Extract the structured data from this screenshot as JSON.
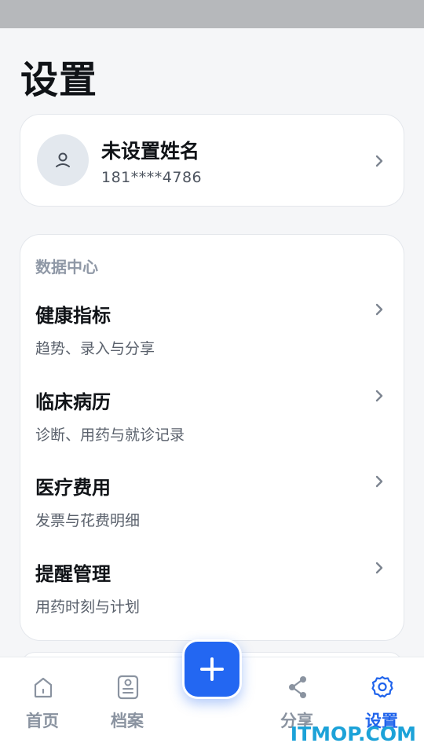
{
  "page": {
    "title": "设置"
  },
  "profile": {
    "name": "未设置姓名",
    "phone": "181****4786"
  },
  "data_center": {
    "label": "数据中心",
    "items": [
      {
        "title": "健康指标",
        "subtitle": "趋势、录入与分享"
      },
      {
        "title": "临床病历",
        "subtitle": "诊断、用药与就诊记录"
      },
      {
        "title": "医疗费用",
        "subtitle": "发票与花费明细"
      },
      {
        "title": "提醒管理",
        "subtitle": "用药时刻与计划"
      }
    ]
  },
  "tabs": [
    {
      "label": "首页",
      "icon": "home-icon"
    },
    {
      "label": "档案",
      "icon": "document-icon"
    },
    {
      "label": "分享",
      "icon": "share-icon"
    },
    {
      "label": "设置",
      "icon": "gear-icon",
      "active": true
    }
  ],
  "fab": {
    "icon": "plus-icon"
  },
  "watermark": "ITMOP.COM",
  "colors": {
    "accent": "#1f63ec",
    "inactive": "#8a93a0",
    "background": "#f5f6f8"
  }
}
